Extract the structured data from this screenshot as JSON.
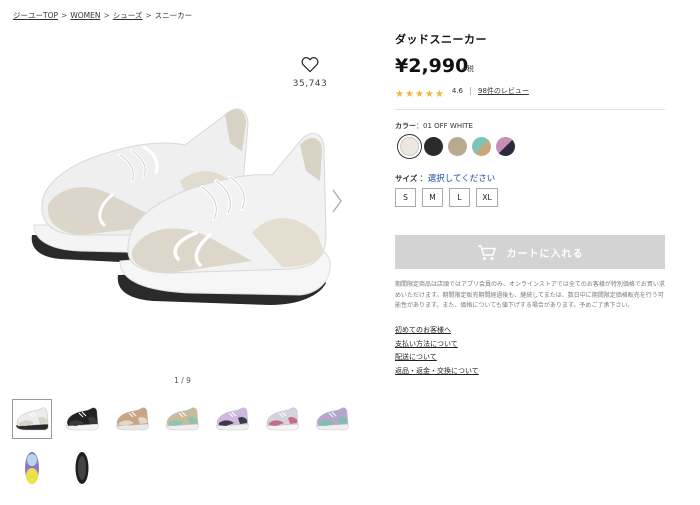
{
  "breadcrumb": {
    "items": [
      "ジーユーTOP",
      "WOMEN",
      "シューズ",
      "スニーカー"
    ],
    "separator": ">"
  },
  "favorite": {
    "icon": "heart-icon",
    "count": "35,743"
  },
  "gallery": {
    "counter": "1 / 9",
    "thumbnails": [
      {
        "name": "off-white",
        "sole": "#2a2a2a",
        "upper": "#ececec",
        "accent": "#d9d3c6"
      },
      {
        "name": "black",
        "sole": "#f4f4f4",
        "upper": "#232323",
        "accent": "#3a3a3a"
      },
      {
        "name": "beige",
        "sole": "#e8e8e8",
        "upper": "#c7a783",
        "accent": "#e4d7c4"
      },
      {
        "name": "mint-multi",
        "sole": "#efefef",
        "upper": "#c6bc9b",
        "accent": "#8bc4b5"
      },
      {
        "name": "purple",
        "sole": "#f0f0f0",
        "upper": "#cfb8df",
        "accent": "#3a3a48"
      },
      {
        "name": "lavender-pink",
        "sole": "#f6f6f6",
        "upper": "#d5d1dd",
        "accent": "#c46d8d"
      },
      {
        "name": "multi-purple",
        "sole": "#efefef",
        "upper": "#b5a6cc",
        "accent": "#79c1ae"
      },
      {
        "name": "sole-view",
        "sole": "#eae24c",
        "upper": "#8e79c7",
        "accent": "#b7d6ea"
      },
      {
        "name": "sole-black",
        "sole": "#1e1e1e",
        "upper": "#1e1e1e",
        "accent": "#444444"
      }
    ]
  },
  "product": {
    "title": "ダッドスニーカー",
    "price": "¥2,990",
    "tax": "+税",
    "rating": {
      "stars": 5,
      "value": "4.6",
      "review_link": "98件のレビュー"
    }
  },
  "color": {
    "label": "カラー",
    "selected": "：01 OFF WHITE",
    "swatches": [
      {
        "name": "off-white",
        "c1": "#ece8df",
        "c2": "#ece8df"
      },
      {
        "name": "black",
        "c1": "#2b2b2b",
        "c2": "#2b2b2b"
      },
      {
        "name": "beige",
        "c1": "#b9a98f",
        "c2": "#b9a98f"
      },
      {
        "name": "mint-multi",
        "c1": "#7cc4b7",
        "c2": "#c7a77c"
      },
      {
        "name": "purple-multi",
        "c1": "#c78eb8",
        "c2": "#2b2b3d"
      }
    ]
  },
  "size": {
    "label": "サイズ",
    "selected": "：選択してください",
    "options": [
      "S",
      "M",
      "L",
      "XL"
    ]
  },
  "cart": {
    "label": "カートに入れる",
    "icon": "cart-icon"
  },
  "notice": "期間限定商品は店頭ではアプリ会員のみ、オンラインストアでは全てのお客様が特別価格でお買い求めいただけます。期間限定販売期間経過後も、継続してまたは、数日中に期間限定価格販売を行う可能性があります。また、価格についても値下げする場合があります。予めご了承下さい。",
  "links": [
    "初めてのお客様へ",
    "支払い方法について",
    "配送について",
    "返品・返金・交換について"
  ],
  "colors": {
    "star": "#f0b63a",
    "size_select": "#1d4da0",
    "cart_bg": "#d3d3d3"
  }
}
